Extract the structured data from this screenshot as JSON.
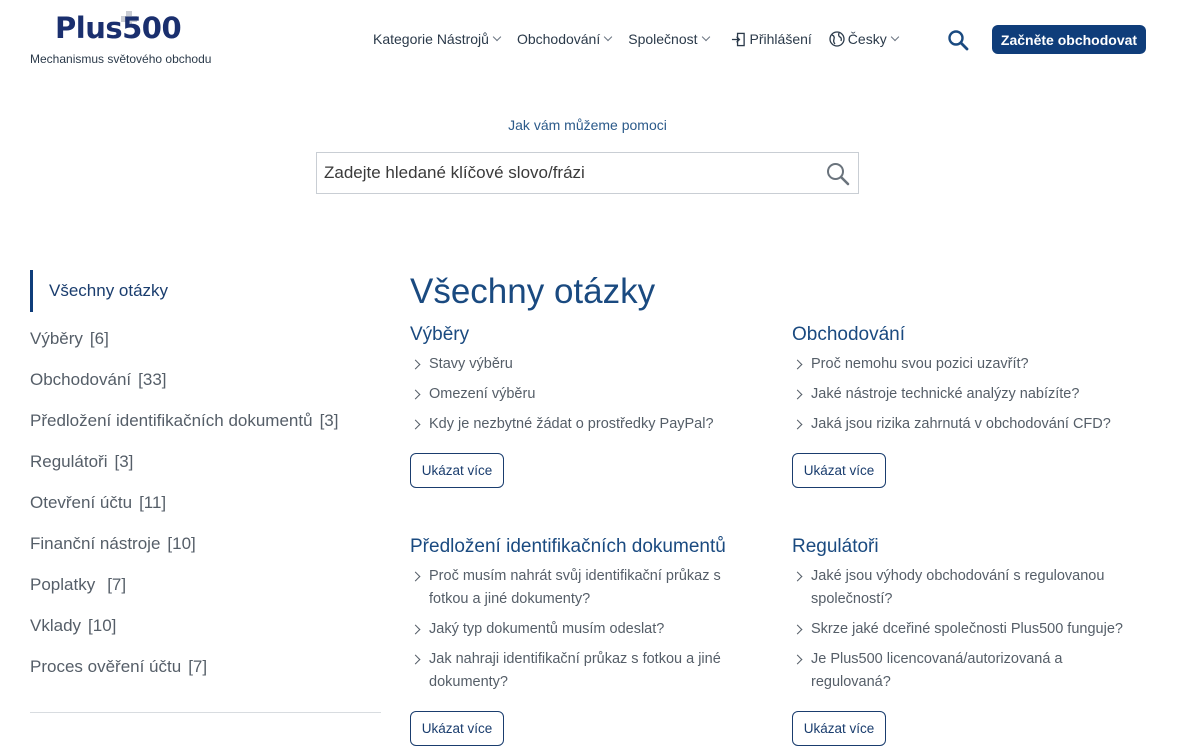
{
  "header": {
    "logo_text": "Plus500",
    "tagline": "Mechanismus světového obchodu",
    "nav": [
      {
        "label": "Kategorie Nástrojů"
      },
      {
        "label": "Obchodování"
      },
      {
        "label": "Společnost"
      }
    ],
    "login_label": "Přihlášení",
    "language_label": "Česky",
    "cta_label": "Začněte obchodovat"
  },
  "search": {
    "heading": "Jak vám můžeme pomoci",
    "placeholder": "Zadejte hledané klíčové slovo/frázi"
  },
  "sidebar": {
    "active_label": "Všechny otázky",
    "items": [
      {
        "label": "Výběry",
        "count": "[6]"
      },
      {
        "label": "Obchodování",
        "count": "[33]"
      },
      {
        "label": "Předložení identifikačních dokumentů",
        "count": "[3]"
      },
      {
        "label": "Regulátoři",
        "count": "[3]"
      },
      {
        "label": "Otevření účtu",
        "count": "[11]"
      },
      {
        "label": "Finanční nástroje",
        "count": "[10]"
      },
      {
        "label": "Poplatky",
        "count": "[7]"
      },
      {
        "label": "Vklady",
        "count": "[10]"
      },
      {
        "label": "Proces ověření účtu",
        "count": "[7]"
      }
    ]
  },
  "main": {
    "title": "Všechny otázky",
    "show_more_label": "Ukázat více",
    "sections": [
      {
        "title": "Výběry",
        "questions": [
          "Stavy výběru",
          "Omezení výběru",
          "Kdy je nezbytné žádat o prostředky PayPal?"
        ]
      },
      {
        "title": "Obchodování",
        "questions": [
          "Proč nemohu svou pozici uzavřít?",
          "Jaké nástroje technické analýzy nabízíte?",
          "Jaká jsou rizika zahrnutá v obchodování CFD?"
        ]
      },
      {
        "title": "Předložení identifikačních dokumentů",
        "questions": [
          "Proč musím nahrát svůj identifikační průkaz s fotkou a jiné dokumenty?",
          "Jaký typ dokumentů musím odeslat?",
          "Jak nahraji identifikační průkaz s fotkou a jiné dokumenty?"
        ]
      },
      {
        "title": "Regulátoři",
        "questions": [
          "Jaké jsou výhody obchodování s regulovanou společností?",
          "Skrze jaké dceřiné společnosti Plus500 funguje?",
          "Je Plus500 licencovaná/autorizovaná a regulovaná?"
        ]
      }
    ]
  },
  "icons": {
    "search": "search-icon",
    "globe": "globe-icon",
    "login": "login-icon",
    "chevron": "chevron-down-icon",
    "question_arrow": "chevron-right-icon"
  },
  "colors": {
    "brand": "#1a2f6e",
    "cta": "#0f3d7a",
    "link": "#1a4a80"
  }
}
